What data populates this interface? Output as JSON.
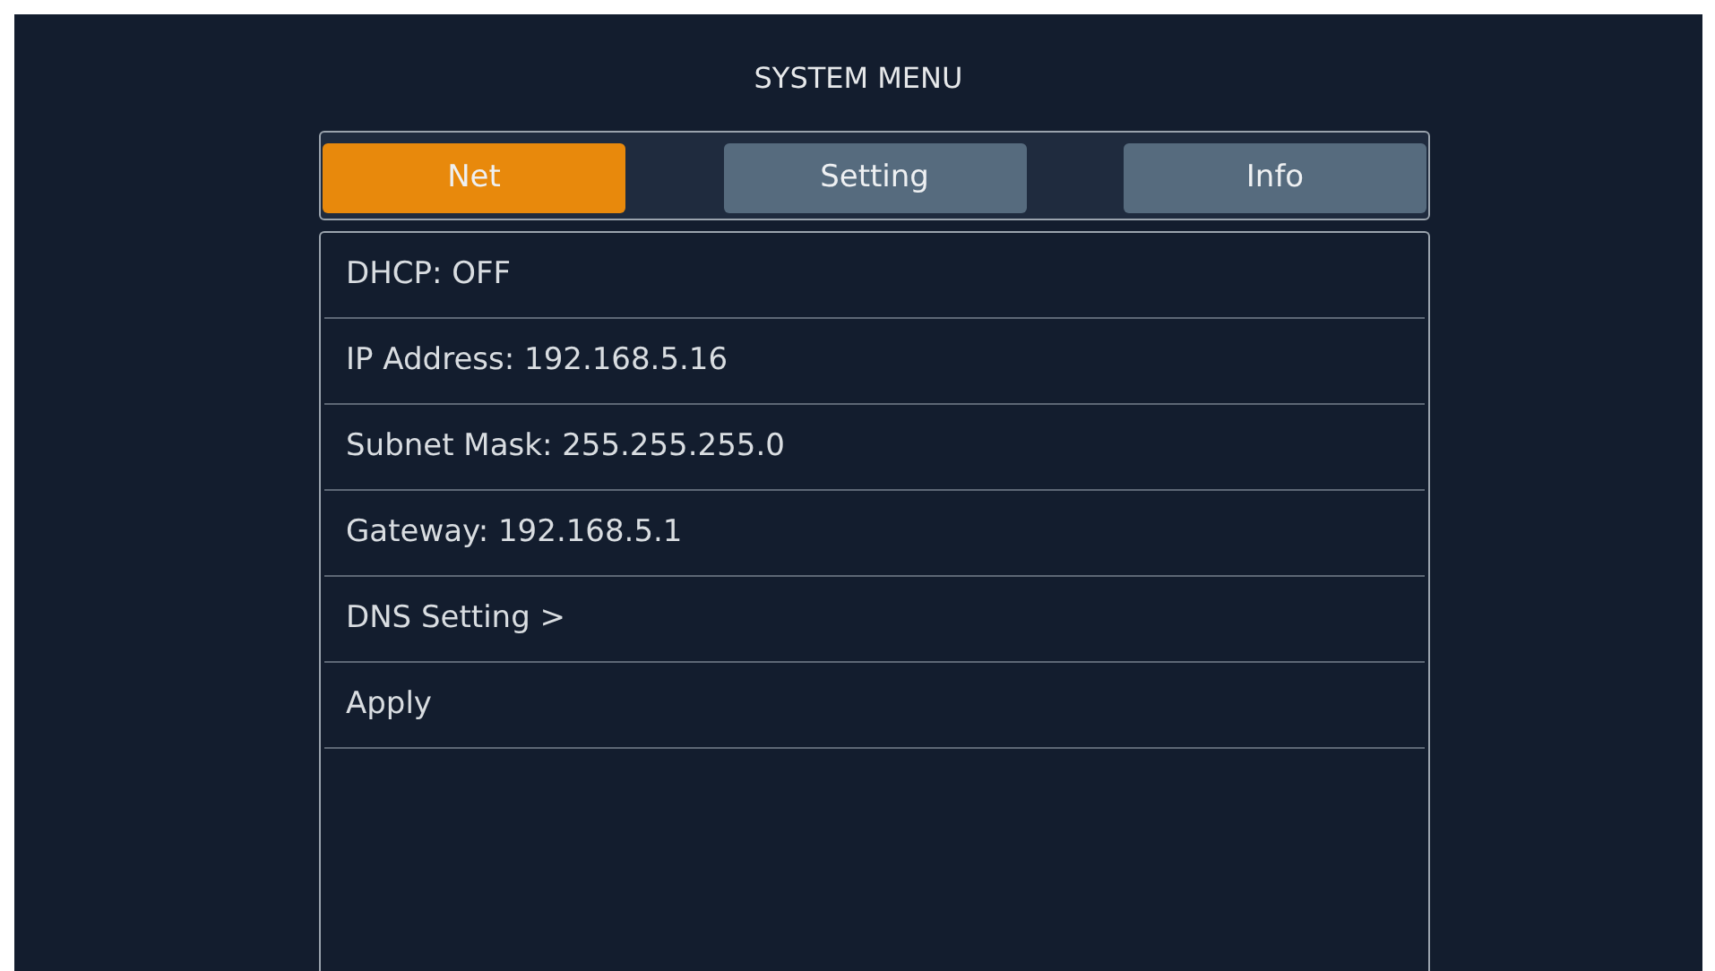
{
  "window": {
    "title": "SYSTEM MENU"
  },
  "tabs": [
    {
      "label": "Net",
      "selected": true
    },
    {
      "label": "Setting",
      "selected": false
    },
    {
      "label": "Info",
      "selected": false
    }
  ],
  "items": [
    {
      "label": "DHCP: OFF"
    },
    {
      "label": "IP Address: 192.168.5.16"
    },
    {
      "label": "Subnet Mask: 255.255.255.0"
    },
    {
      "label": "Gateway: 192.168.5.1"
    },
    {
      "label": "DNS Setting >"
    },
    {
      "label": "Apply"
    }
  ]
}
